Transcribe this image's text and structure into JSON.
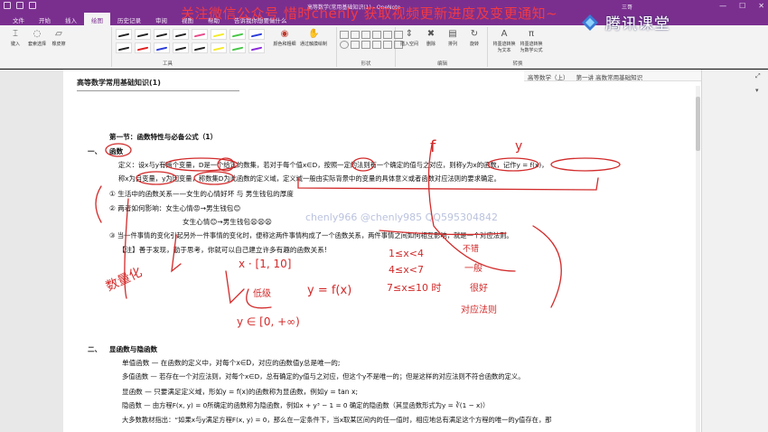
{
  "window": {
    "doc_title": "高等数学(常用基础知识(1) - OneNote",
    "user": "三哥",
    "controls": [
      "—",
      "☐",
      "✕"
    ]
  },
  "watermark": {
    "text": "关注微信公众号 惜时chenly 获取视频更新进度及变更通知~",
    "brand": "腾讯课堂",
    "qq": "chenly966 @chenly985 QQ595304842"
  },
  "ribbon": {
    "tabs": [
      "文件",
      "开始",
      "插入",
      "绘图",
      "历史记录",
      "审阅",
      "视图",
      "帮助",
      "告诉我你想要做什么"
    ],
    "active_tab": "绘图",
    "tools_buttons": [
      {
        "label": "键入",
        "icon": "cursor-icon"
      },
      {
        "label": "套索选择",
        "icon": "lasso-icon"
      },
      {
        "label": "橡皮擦",
        "icon": "eraser-icon"
      }
    ],
    "tools_group_label": "工具",
    "pen_colors": [
      "#222222",
      "#222222",
      "#222222",
      "#222222",
      "#e84a8a",
      "#f4ea2a",
      "#46c646",
      "#2a3bd8",
      "#222222",
      "#e02020",
      "#2a3bd8",
      "#222222",
      "#222222",
      "#f4ea2a",
      "#46c646",
      "#8a2ad8"
    ],
    "color_button": "颜色和粗细",
    "draw_button": "通过触摸绘制",
    "shapes_group_label": "形状",
    "insert_space": "插入空间",
    "delete": "删除",
    "arrange": "排列",
    "rotate": "旋转",
    "edit_group_label": "编辑",
    "ink_to_text": "将墨迹转换为文本",
    "ink_to_math": "将墨迹转换为数学公式",
    "convert_group_label": "转换"
  },
  "breadcrumb": [
    "高等数学（上）",
    "第一讲 高数常用基础知识"
  ],
  "page": {
    "title": "高等数学常用基础知识(1)",
    "section1_heading": "第一节：函数特性与必备公式（1）",
    "part1_num": "一、",
    "part1_title": "函数",
    "def_line1": "定义：设x与y有两个变量，D是一个给定的数集，若对于每个值x∈D，按照一定的法则有一个确定的值与之对应，则称y为x的函数，记作y = f(x)，",
    "def_line2": "称x为自变量，y为因变量，称数集D为此函数的定义域，定义域一般由实际背景中的变量的具体意义或者函数对应法则的要求确定。",
    "item1": "①  生活中的函数关系——女生的心情好坏 与 男生钱包的厚度",
    "item2a": "②  两者如何影响：女生心情😡→男生钱包😊",
    "item2b": "女生心情😊→男生钱包😫😫😫",
    "item3": "③  当一件事情的变化引起另外一件事情的变化时，便称这两件事情构成了一个函数关系，两件事情之间如何相互影响，就是一个对应法则。",
    "note": "【注】善于发现，勤于思考，你就可以自己建立许多有趣的函数关系!",
    "part2_num": "二、",
    "part2_title": "显函数与隐函数",
    "single": "单值函数 — 在函数的定义中，对每个x∈D，对应的函数值y总是唯一的;",
    "multi": "多值函数 — 若存在一个对应法则，对每个x∈D，总有确定的y值与之对应，但这个y不是唯一的；但是这样的对应法则不符合函数的定义。",
    "explicit": "显函数 — 只要满足定义域，形如y = f(x)的函数称为显函数，例如y = tan x;",
    "implicit": "隐函数 — 由方程F(x, y) = 0所确定的函数称为隐函数，例如x + y³ − 1 = 0 确定的隐函数（其显函数形式为y = ∛(1 − x)）",
    "textbook": "大多数教材指出：“如果x与y满足方程F(x, y) = 0，那么在一定条件下，当x取某区间内的任一值时，相应地总有满足这个方程的唯一的y值存在，那"
  },
  "handwriting": {
    "quantify": "数量化",
    "x_interval": "x · [1, 10]",
    "cond1": "1≤x<4",
    "cond2": "4≤x<7",
    "cond3": "7≤x≤10 时",
    "note1": "不错",
    "note2": "一般",
    "note3": "很好",
    "rule": "对应法则",
    "fx": "y = f(x)",
    "range": "y ∈ [0, +∞)",
    "letters": [
      "f",
      "y"
    ],
    "tag": "低级"
  }
}
